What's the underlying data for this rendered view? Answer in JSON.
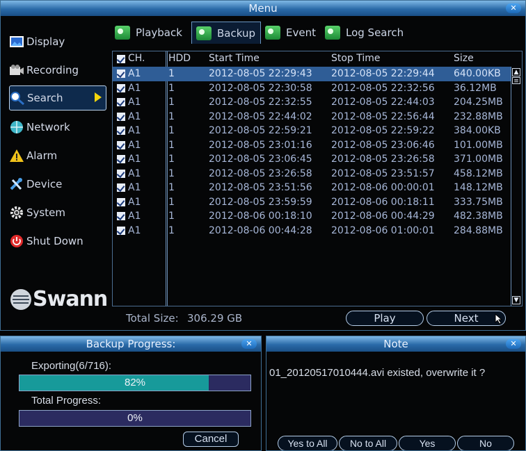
{
  "menu": {
    "title": "Menu",
    "sidebar": [
      {
        "label": "Display",
        "icon": "display-icon"
      },
      {
        "label": "Recording",
        "icon": "recording-icon"
      },
      {
        "label": "Search",
        "icon": "search-icon"
      },
      {
        "label": "Network",
        "icon": "network-icon"
      },
      {
        "label": "Alarm",
        "icon": "alarm-icon"
      },
      {
        "label": "Device",
        "icon": "device-icon"
      },
      {
        "label": "System",
        "icon": "system-icon"
      },
      {
        "label": "Shut Down",
        "icon": "shutdown-icon"
      }
    ],
    "logo": "Swann",
    "tabs": [
      {
        "label": "Playback"
      },
      {
        "label": "Backup"
      },
      {
        "label": "Event"
      },
      {
        "label": "Log Search"
      }
    ],
    "columns": {
      "ch": "CH.",
      "hdd": "HDD",
      "start": "Start Time",
      "stop": "Stop Time",
      "size": "Size"
    },
    "rows": [
      {
        "ch": "A1",
        "hdd": "1",
        "start": "2012-08-05 22:29:43",
        "stop": "2012-08-05 22:29:44",
        "size": "640.00KB"
      },
      {
        "ch": "A1",
        "hdd": "1",
        "start": "2012-08-05 22:30:58",
        "stop": "2012-08-05 22:32:56",
        "size": "36.12MB"
      },
      {
        "ch": "A1",
        "hdd": "1",
        "start": "2012-08-05 22:32:55",
        "stop": "2012-08-05 22:44:03",
        "size": "204.25MB"
      },
      {
        "ch": "A1",
        "hdd": "1",
        "start": "2012-08-05 22:44:02",
        "stop": "2012-08-05 22:56:44",
        "size": "232.88MB"
      },
      {
        "ch": "A1",
        "hdd": "1",
        "start": "2012-08-05 22:59:21",
        "stop": "2012-08-05 22:59:22",
        "size": "384.00KB"
      },
      {
        "ch": "A1",
        "hdd": "1",
        "start": "2012-08-05 23:01:16",
        "stop": "2012-08-05 23:06:46",
        "size": "101.00MB"
      },
      {
        "ch": "A1",
        "hdd": "1",
        "start": "2012-08-05 23:06:45",
        "stop": "2012-08-05 23:26:58",
        "size": "371.00MB"
      },
      {
        "ch": "A1",
        "hdd": "1",
        "start": "2012-08-05 23:26:58",
        "stop": "2012-08-05 23:51:57",
        "size": "458.12MB"
      },
      {
        "ch": "A1",
        "hdd": "1",
        "start": "2012-08-05 23:51:56",
        "stop": "2012-08-06 00:00:01",
        "size": "148.12MB"
      },
      {
        "ch": "A1",
        "hdd": "1",
        "start": "2012-08-05 23:59:59",
        "stop": "2012-08-06 00:18:11",
        "size": "333.75MB"
      },
      {
        "ch": "A1",
        "hdd": "1",
        "start": "2012-08-06 00:18:10",
        "stop": "2012-08-06 00:44:29",
        "size": "482.38MB"
      },
      {
        "ch": "A1",
        "hdd": "1",
        "start": "2012-08-06 00:44:28",
        "stop": "2012-08-06 01:00:01",
        "size": "284.88MB"
      }
    ],
    "total_label": "Total Size:",
    "total_value": "306.29 GB",
    "play_label": "Play",
    "next_label": "Next"
  },
  "backup_progress": {
    "title": "Backup Progress:",
    "exporting_label": "Exporting(6/716):",
    "export_percent": "82%",
    "export_fraction": 0.82,
    "total_label": "Total Progress:",
    "total_percent": "0%",
    "total_fraction": 0,
    "cancel_label": "Cancel"
  },
  "note": {
    "title": "Note",
    "message": "01_20120517010444.avi existed, overwrite it ?",
    "buttons": [
      "Yes to All",
      "No to All",
      "Yes",
      "No"
    ]
  },
  "colors": {
    "accent": "#2f5d96",
    "titlebar": "#2a6aa8",
    "progress": "#179a9a",
    "arrow": "#f4d50c"
  }
}
